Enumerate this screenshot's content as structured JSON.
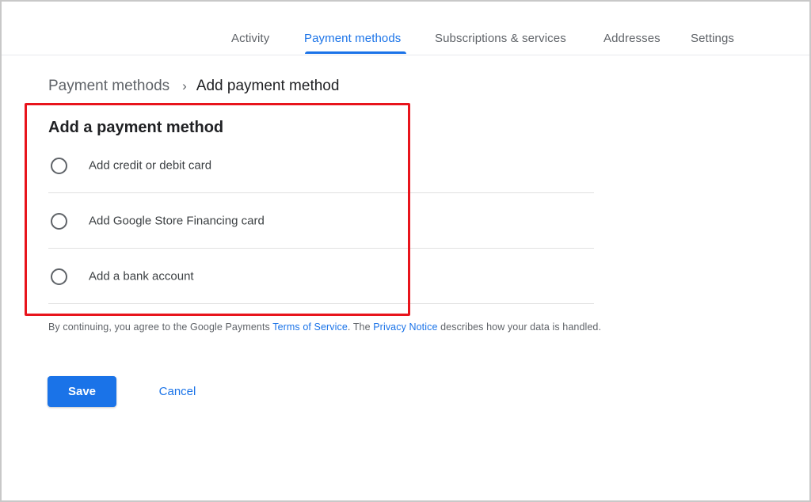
{
  "nav": {
    "tabs": [
      {
        "label": "Activity",
        "active": false
      },
      {
        "label": "Payment methods",
        "active": true
      },
      {
        "label": "Subscriptions & services",
        "active": false
      },
      {
        "label": "Addresses",
        "active": false
      },
      {
        "label": "Settings",
        "active": false
      }
    ]
  },
  "breadcrumb": {
    "parent": "Payment methods",
    "separator": "›",
    "current": "Add payment method"
  },
  "form": {
    "title": "Add a payment method",
    "options": [
      {
        "label": "Add credit or debit card",
        "selected": false
      },
      {
        "label": "Add Google Store Financing card",
        "selected": false
      },
      {
        "label": "Add a bank account",
        "selected": false
      }
    ]
  },
  "legal": {
    "text_1": "By continuing, you agree to the Google Payments ",
    "terms_link": "Terms of Service",
    "text_2": ". The ",
    "privacy_link": "Privacy Notice",
    "text_3": " describes how your data is handled."
  },
  "actions": {
    "save_label": "Save",
    "cancel_label": "Cancel"
  },
  "colors": {
    "accent": "#1a73e8",
    "highlight": "#e8141c",
    "text_secondary": "#5f6368"
  }
}
